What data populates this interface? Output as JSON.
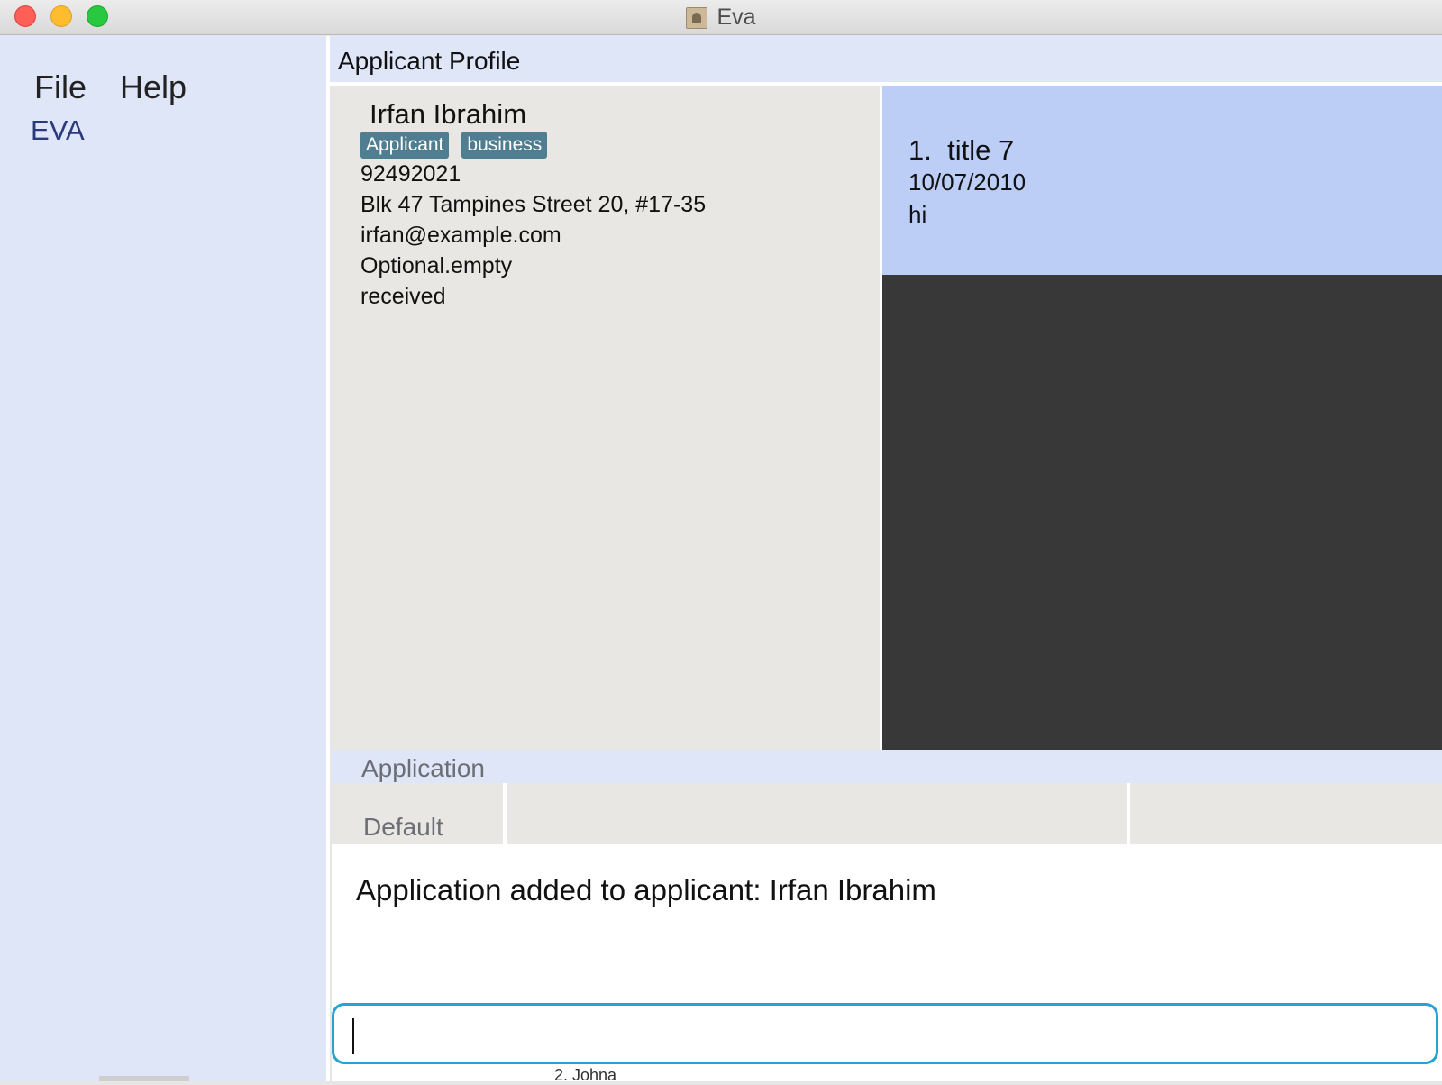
{
  "window": {
    "title": "Eva",
    "controls": {
      "close": "close",
      "minimize": "minimize",
      "zoom": "zoom"
    }
  },
  "menu": {
    "items": [
      {
        "label": "File"
      },
      {
        "label": "Help"
      }
    ]
  },
  "sidebar": {
    "brand": "EVA"
  },
  "profile": {
    "header": "Applicant Profile",
    "name": "Irfan Ibrahim",
    "tags": [
      "Applicant",
      "business"
    ],
    "phone": "92492021",
    "address": "Blk 47 Tampines Street 20, #17-35",
    "email": "irfan@example.com",
    "optional": "Optional.empty",
    "status": "received"
  },
  "applications": [
    {
      "index": "1.",
      "title": "title 7",
      "date": "10/07/2010",
      "description": "hi"
    }
  ],
  "application_panel": {
    "tab_label": "Application",
    "status_label": "Default"
  },
  "result": {
    "message": "Application added to applicant: Irfan Ibrahim"
  },
  "command": {
    "value": "",
    "placeholder": ""
  },
  "background_peek": {
    "text": "2. Johna"
  },
  "colors": {
    "tag": "#4f7e91",
    "selected_card": "#bccdf6",
    "panel_bg": "#dfe6f8",
    "command_border": "#25a3d1"
  }
}
